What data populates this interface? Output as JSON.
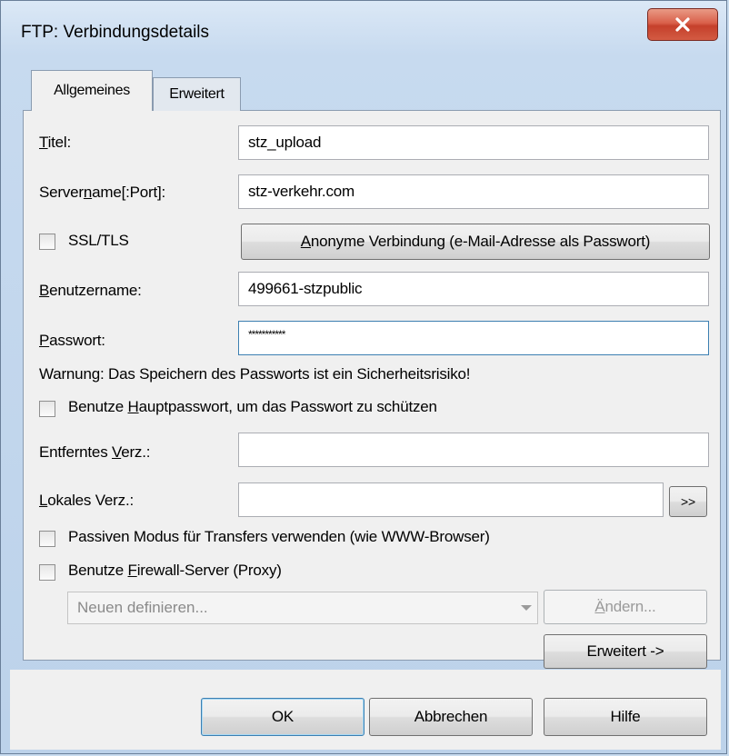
{
  "window": {
    "title": "FTP: Verbindungsdetails"
  },
  "tabs": [
    {
      "label": "Allgemeines",
      "active": true
    },
    {
      "label": "Erweitert",
      "active": false
    }
  ],
  "form": {
    "title_label_u": "T",
    "title_label_rest": "itel:",
    "title_value": "stz_upload",
    "server_label_a": "Server",
    "server_label_u": "n",
    "server_label_b": "ame[:Port]:",
    "server_value": "stz-verkehr.com",
    "ssl_label": "SSL/TLS",
    "ssl_checked": false,
    "anon_button_u": "A",
    "anon_button_rest": "nonyme Verbindung (e-Mail-Adresse als Passwort)",
    "user_label_u": "B",
    "user_label_rest": "enutzername:",
    "user_value": "499661-stzpublic",
    "pass_label_u": "P",
    "pass_label_rest": "asswort:",
    "pass_value": "***********",
    "warning": "Warnung: Das Speichern des Passworts ist ein Sicherheitsrisiko!",
    "master_a": "Benutze ",
    "master_u": "H",
    "master_b": "auptpasswort, um das Passwort zu schützen",
    "remote_label_a": "Entferntes ",
    "remote_label_u": "V",
    "remote_label_b": "erz.:",
    "remote_value": "",
    "local_label_u": "L",
    "local_label_rest": "okales Verz.:",
    "local_value": "",
    "browse_button": ">>",
    "passive_label": "Passiven Modus für Transfers verwenden (wie WWW-Browser)",
    "firewall_a": "Benutze ",
    "firewall_u": "F",
    "firewall_b": "irewall-Server (Proxy)",
    "proxy_select": "Neuen definieren...",
    "change_u": "Ä",
    "change_rest": "ndern...",
    "advanced_button": "Erweitert ->"
  },
  "footer": {
    "ok": "OK",
    "cancel": "Abbrechen",
    "help": "Hilfe"
  },
  "colors": {
    "close": "#c5402b",
    "focus": "#3c7fb1"
  }
}
